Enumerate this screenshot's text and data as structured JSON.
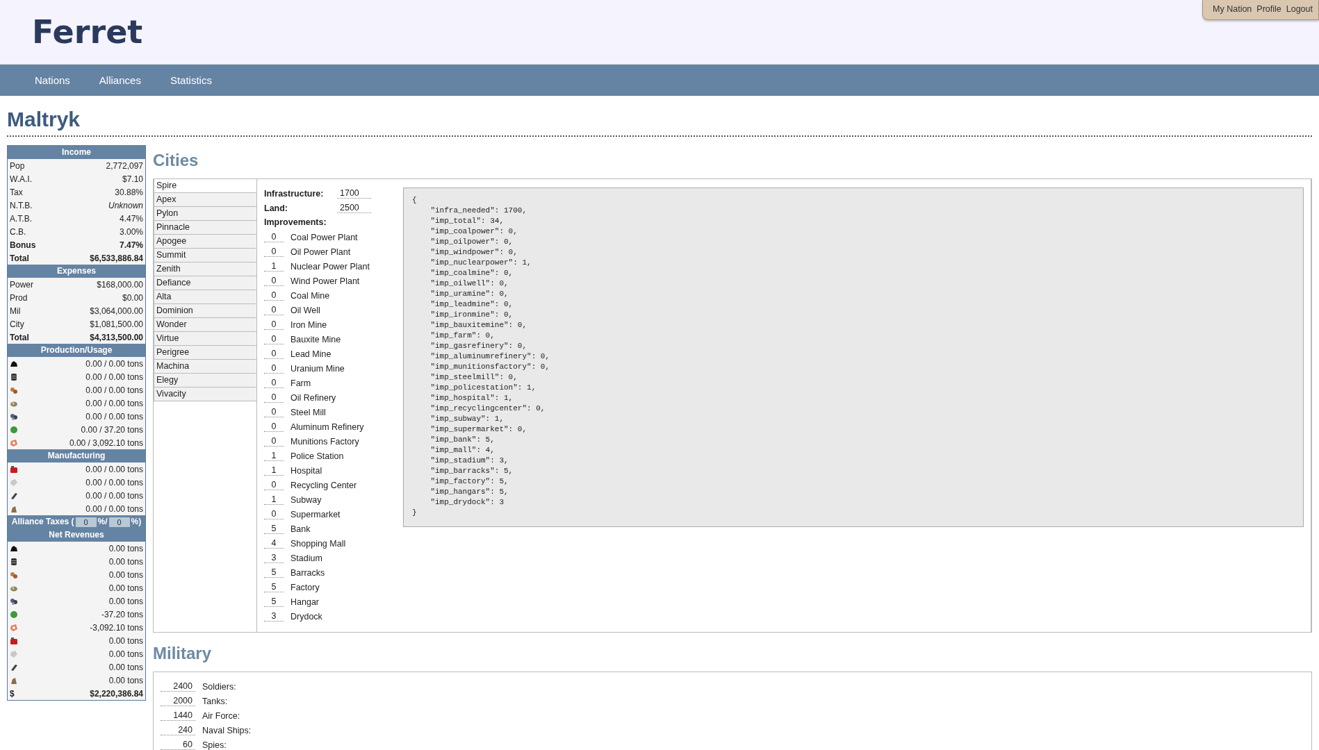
{
  "header": {
    "logo": "Ferret",
    "user_menu": [
      "My Nation",
      "Profile",
      "Logout"
    ]
  },
  "nav": [
    "Nations",
    "Alliances",
    "Statistics"
  ],
  "nation_name": "Maltryk",
  "sidebar": {
    "income": {
      "title": "Income",
      "rows": [
        {
          "label": "Pop",
          "value": "2,772,097",
          "kind": "figure"
        },
        {
          "label": "W.A.I.",
          "value": "$7.10",
          "kind": "figure"
        },
        {
          "label": "Tax",
          "value": "30.88%",
          "kind": "figure"
        },
        {
          "label": "N.T.B.",
          "value": "Unknown",
          "kind": "unknown"
        },
        {
          "label": "A.T.B.",
          "value": "4.47%",
          "kind": "figure"
        },
        {
          "label": "C.B.",
          "value": "3.00%",
          "kind": "figure"
        },
        {
          "label": "Bonus",
          "value": "7.47%",
          "kind": "summary"
        },
        {
          "label": "Total",
          "value": "$6,533,886.84",
          "kind": "summary"
        }
      ]
    },
    "expenses": {
      "title": "Expenses",
      "rows": [
        {
          "label": "Power",
          "value": "$168,000.00",
          "kind": "figure"
        },
        {
          "label": "Prod",
          "value": "$0.00",
          "kind": "figure"
        },
        {
          "label": "Mil",
          "value": "$3,064,000.00",
          "kind": "figure"
        },
        {
          "label": "City",
          "value": "$1,081,500.00",
          "kind": "figure"
        },
        {
          "label": "Total",
          "value": "$4,313,500.00",
          "kind": "summary"
        }
      ]
    },
    "production": {
      "title": "Production/Usage",
      "rows": [
        "0.00 / 0.00 tons",
        "0.00 / 0.00 tons",
        "0.00 / 0.00 tons",
        "0.00 / 0.00 tons",
        "0.00 / 0.00 tons",
        "0.00 / 37.20 tons",
        "0.00 / 3,092.10 tons"
      ]
    },
    "manufacturing": {
      "title": "Manufacturing",
      "rows": [
        "0.00 / 0.00 tons",
        "0.00 / 0.00 tons",
        "0.00 / 0.00 tons",
        "0.00 / 0.00 tons"
      ]
    },
    "alliance_taxes": {
      "label_start": "Alliance Taxes (",
      "first_value": "0",
      "separator": "%/",
      "second_value": "0",
      "label_end": "%)"
    },
    "net_revenues": {
      "title": "Net Revenues",
      "rows": [
        "0.00 tons",
        "0.00 tons",
        "0.00 tons",
        "0.00 tons",
        "0.00 tons",
        "-37.20 tons",
        "-3,092.10 tons",
        "0.00 tons",
        "0.00 tons",
        "0.00 tons",
        "0.00 tons"
      ],
      "money_label": "$",
      "money_value": "$2,220,386.84"
    }
  },
  "cities": {
    "title": "Cities",
    "list": [
      {
        "name": "Spire",
        "selected": true
      },
      {
        "name": "Apex",
        "selected": false
      },
      {
        "name": "Pylon",
        "selected": false
      },
      {
        "name": "Pinnacle",
        "selected": false
      },
      {
        "name": "Apogee",
        "selected": false
      },
      {
        "name": "Summit",
        "selected": false
      },
      {
        "name": "Zenith",
        "selected": false
      },
      {
        "name": "Defiance",
        "selected": false
      },
      {
        "name": "Alta",
        "selected": false
      },
      {
        "name": "Dominion",
        "selected": false
      },
      {
        "name": "Wonder",
        "selected": false
      },
      {
        "name": "Virtue",
        "selected": false
      },
      {
        "name": "Perigree",
        "selected": false
      },
      {
        "name": "Machina",
        "selected": false
      },
      {
        "name": "Elegy",
        "selected": false
      },
      {
        "name": "Vivacity",
        "selected": false
      }
    ],
    "infrastructure_label": "Infrastructure:",
    "infrastructure": "1700",
    "land_label": "Land:",
    "land": "2500",
    "improvements_label": "Improvements:",
    "improvements": [
      {
        "count": "0",
        "name": "Coal Power Plant"
      },
      {
        "count": "0",
        "name": "Oil Power Plant"
      },
      {
        "count": "1",
        "name": "Nuclear Power Plant"
      },
      {
        "count": "0",
        "name": "Wind Power Plant"
      },
      {
        "count": "0",
        "name": "Coal Mine"
      },
      {
        "count": "0",
        "name": "Oil Well"
      },
      {
        "count": "0",
        "name": "Iron Mine"
      },
      {
        "count": "0",
        "name": "Bauxite Mine"
      },
      {
        "count": "0",
        "name": "Lead Mine"
      },
      {
        "count": "0",
        "name": "Uranium Mine"
      },
      {
        "count": "0",
        "name": "Farm"
      },
      {
        "count": "0",
        "name": "Oil Refinery"
      },
      {
        "count": "0",
        "name": "Steel Mill"
      },
      {
        "count": "0",
        "name": "Aluminum Refinery"
      },
      {
        "count": "0",
        "name": "Munitions Factory"
      },
      {
        "count": "1",
        "name": "Police Station"
      },
      {
        "count": "1",
        "name": "Hospital"
      },
      {
        "count": "0",
        "name": "Recycling Center"
      },
      {
        "count": "1",
        "name": "Subway"
      },
      {
        "count": "0",
        "name": "Supermarket"
      },
      {
        "count": "5",
        "name": "Bank"
      },
      {
        "count": "4",
        "name": "Shopping Mall"
      },
      {
        "count": "3",
        "name": "Stadium"
      },
      {
        "count": "5",
        "name": "Barracks"
      },
      {
        "count": "5",
        "name": "Factory"
      },
      {
        "count": "5",
        "name": "Hangar"
      },
      {
        "count": "3",
        "name": "Drydock"
      }
    ],
    "json_dump": [
      "{",
      "    \"infra_needed\": 1700,",
      "    \"imp_total\": 34,",
      "    \"imp_coalpower\": 0,",
      "    \"imp_oilpower\": 0,",
      "    \"imp_windpower\": 0,",
      "    \"imp_nuclearpower\": 1,",
      "    \"imp_coalmine\": 0,",
      "    \"imp_oilwell\": 0,",
      "    \"imp_uramine\": 0,",
      "    \"imp_leadmine\": 0,",
      "    \"imp_ironmine\": 0,",
      "    \"imp_bauxitemine\": 0,",
      "    \"imp_farm\": 0,",
      "    \"imp_gasrefinery\": 0,",
      "    \"imp_aluminumrefinery\": 0,",
      "    \"imp_munitionsfactory\": 0,",
      "    \"imp_steelmill\": 0,",
      "    \"imp_policestation\": 1,",
      "    \"imp_hospital\": 1,",
      "    \"imp_recyclingcenter\": 0,",
      "    \"imp_subway\": 1,",
      "    \"imp_supermarket\": 0,",
      "    \"imp_bank\": 5,",
      "    \"imp_mall\": 4,",
      "    \"imp_stadium\": 3,",
      "    \"imp_barracks\": 5,",
      "    \"imp_factory\": 5,",
      "    \"imp_hangars\": 5,",
      "    \"imp_drydock\": 3",
      "}"
    ]
  },
  "military": {
    "title": "Military",
    "units": [
      {
        "count": "2400",
        "name": "Soldiers:"
      },
      {
        "count": "2000",
        "name": "Tanks:"
      },
      {
        "count": "1440",
        "name": "Air Force:"
      },
      {
        "count": "240",
        "name": "Naval Ships:"
      },
      {
        "count": "60",
        "name": "Spies:"
      }
    ]
  }
}
